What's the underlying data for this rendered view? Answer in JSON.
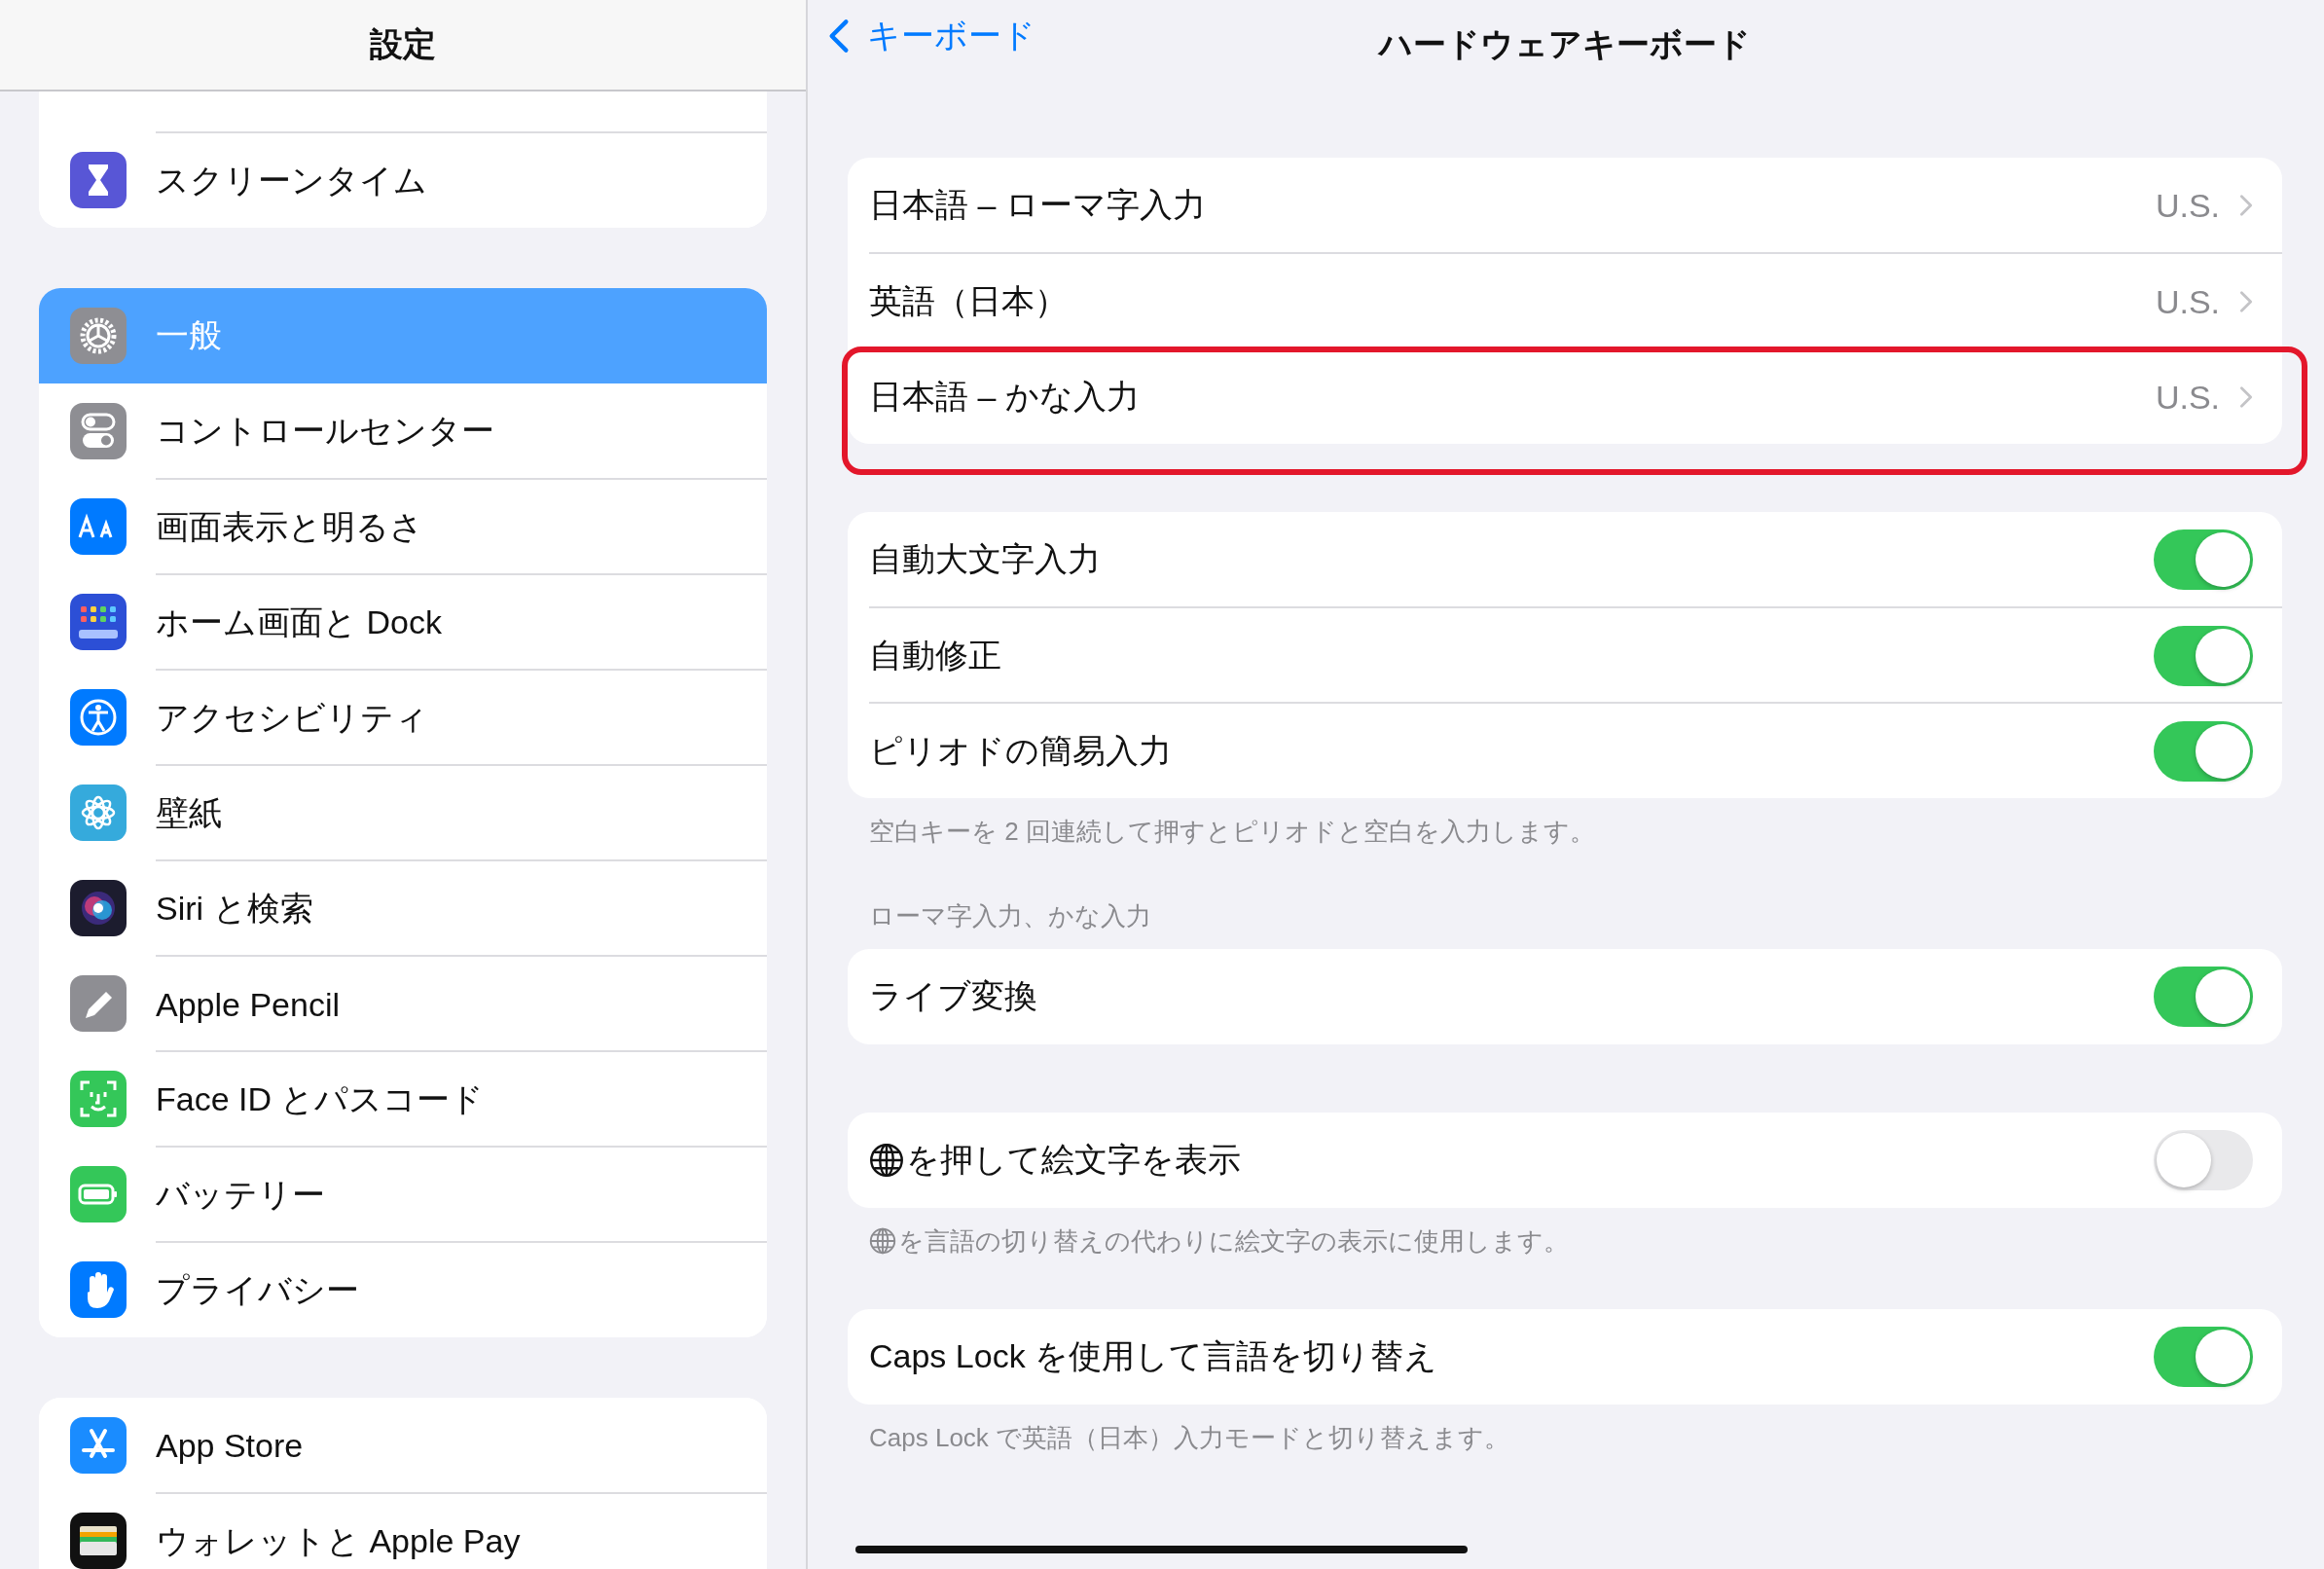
{
  "sidebar": {
    "title": "設定",
    "groups": [
      {
        "items": [
          {
            "label": "スクリーンタイム",
            "selected": false
          }
        ]
      },
      {
        "items": [
          {
            "label": "一般",
            "selected": true
          },
          {
            "label": "コントロールセンター",
            "selected": false
          },
          {
            "label": "画面表示と明るさ",
            "selected": false
          },
          {
            "label": "ホーム画面と Dock",
            "selected": false
          },
          {
            "label": "アクセシビリティ",
            "selected": false
          },
          {
            "label": "壁紙",
            "selected": false
          },
          {
            "label": "Siri と検索",
            "selected": false
          },
          {
            "label": "Apple Pencil",
            "selected": false
          },
          {
            "label": "Face ID とパスコード",
            "selected": false
          },
          {
            "label": "バッテリー",
            "selected": false
          },
          {
            "label": "プライバシー",
            "selected": false
          }
        ]
      },
      {
        "items": [
          {
            "label": "App Store",
            "selected": false
          },
          {
            "label": "ウォレットと Apple Pay",
            "selected": false
          }
        ]
      }
    ]
  },
  "detail": {
    "back_label": "キーボード",
    "title": "ハードウェアキーボード",
    "sections": [
      {
        "rows": [
          {
            "kind": "link",
            "label": "日本語 – ローマ字入力",
            "value": "U.S.",
            "highlighted": false
          },
          {
            "kind": "link",
            "label": "英語（日本）",
            "value": "U.S.",
            "highlighted": false
          },
          {
            "kind": "link",
            "label": "日本語 – かな入力",
            "value": "U.S.",
            "highlighted": true
          }
        ]
      },
      {
        "rows": [
          {
            "kind": "toggle",
            "label": "自動大文字入力",
            "on": true
          },
          {
            "kind": "toggle",
            "label": "自動修正",
            "on": true
          },
          {
            "kind": "toggle",
            "label": "ピリオドの簡易入力",
            "on": true
          }
        ],
        "footer": {
          "kind": "note",
          "text": "空白キーを 2 回連続して押すとピリオドと空白を入力します。"
        }
      },
      {
        "header": "ローマ字入力、かな入力",
        "rows": [
          {
            "kind": "toggle",
            "label": "ライブ変換",
            "on": true
          }
        ]
      },
      {
        "rows": [
          {
            "kind": "globe-toggle",
            "label": "を押して絵文字を表示",
            "on": false
          }
        ],
        "footer": {
          "kind": "globe-note",
          "text": "を言語の切り替えの代わりに絵文字の表示に使用します。"
        }
      },
      {
        "rows": [
          {
            "kind": "toggle",
            "label": "Caps Lock を使用して言語を切り替え",
            "on": true
          }
        ],
        "footer": {
          "kind": "note",
          "text": "Caps Lock で英語（日本）入力モードと切り替えます。"
        }
      }
    ]
  }
}
